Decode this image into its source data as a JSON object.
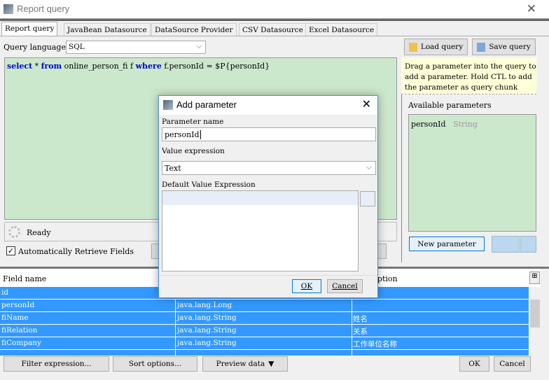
{
  "window": {
    "title": "Report query",
    "close_icon": "close-icon"
  },
  "tabs": [
    "Report query",
    "JavaBean Datasource",
    "DataSource Provider",
    "CSV Datasource",
    "Excel Datasource"
  ],
  "query": {
    "language_label": "Query language",
    "language": "SQL",
    "load_label": "Load query",
    "save_label": "Save query",
    "sql": {
      "kw1": "select",
      "p1": " * ",
      "kw2": "from",
      "p2": " online_person_fi f ",
      "kw3": "where",
      "p3": " f.personId = $P{personId}"
    }
  },
  "status": {
    "text": "Ready",
    "auto_retrieve_label": "Automatically Retrieve Fields",
    "auto_retrieve_checked": true
  },
  "hint": "Drag a parameter into the query to add a parameter. Hold CTL to add the parameter as query chunk",
  "params": {
    "label": "Available parameters",
    "items": [
      {
        "name": "personId",
        "type": "String"
      }
    ],
    "new_label": "New parameter"
  },
  "fields": {
    "headers": [
      "Field name",
      "",
      "Description"
    ],
    "rows": [
      [
        "id",
        "",
        ""
      ],
      [
        "personId",
        "java.lang.Long",
        ""
      ],
      [
        "fiName",
        "java.lang.String",
        "姓名"
      ],
      [
        "fiRelation",
        "java.lang.String",
        "关系"
      ],
      [
        "fiCompany",
        "java.lang.String",
        "工作单位名称"
      ]
    ],
    "selection_color": "#3399ff"
  },
  "bottom": {
    "filter_label": "Filter expression...",
    "sort_label": "Sort options...",
    "preview_label": "Preview data",
    "ok_label": "OK",
    "cancel_label": "Cancel"
  },
  "dialog": {
    "title": "Add parameter",
    "name_label": "Parameter name",
    "name_value": "personId",
    "value_expr_label": "Value expression",
    "value_expr": "Text",
    "default_label": "Default Value Expression",
    "ok_label": "OK",
    "cancel_label": "Cancel"
  }
}
